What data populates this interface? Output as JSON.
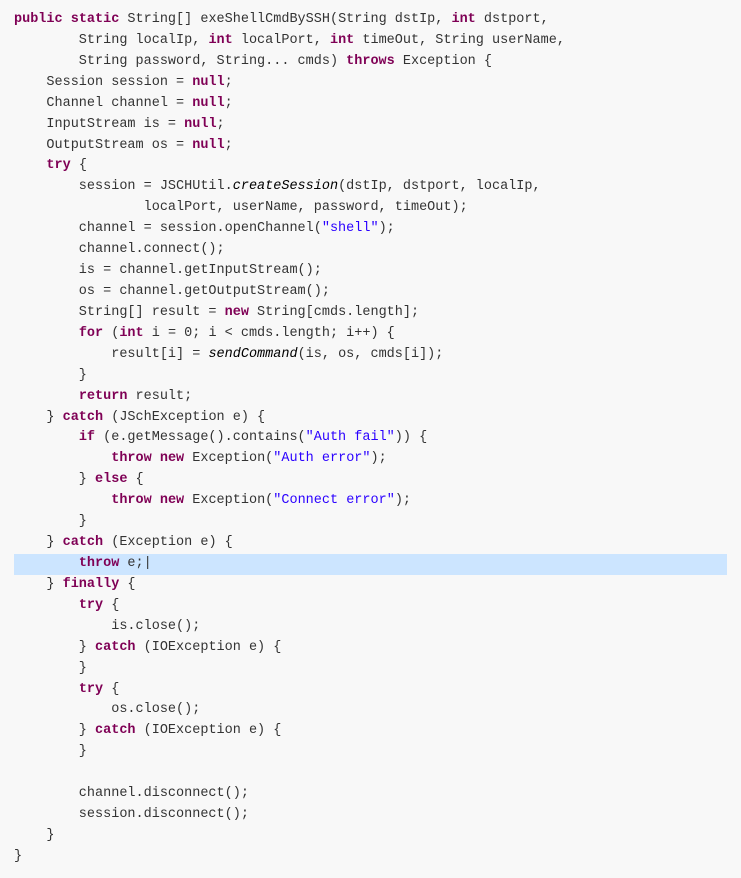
{
  "code": {
    "highlighted_line": 27,
    "lines": [
      {
        "id": 1,
        "html": "<span class='kw'>public</span> <span class='kw'>static</span> String[] exeShellCmdBySSH(String dstIp, <span class='kw'>int</span> dstport,"
      },
      {
        "id": 2,
        "html": "        String localIp, <span class='kw'>int</span> localPort, <span class='kw'>int</span> timeOut, String userName,"
      },
      {
        "id": 3,
        "html": "        String password, String... cmds) <span class='kw'>throws</span> Exception {"
      },
      {
        "id": 4,
        "html": "    Session session = <span class='kw'>null</span>;"
      },
      {
        "id": 5,
        "html": "    Channel channel = <span class='kw'>null</span>;"
      },
      {
        "id": 6,
        "html": "    InputStream is = <span class='kw'>null</span>;"
      },
      {
        "id": 7,
        "html": "    OutputStream os = <span class='kw'>null</span>;"
      },
      {
        "id": 8,
        "html": "    <span class='kw'>try</span> {"
      },
      {
        "id": 9,
        "html": "        session = JSCHUtil.<span class='method-italic'>createSession</span>(dstIp, dstport, localIp,"
      },
      {
        "id": 10,
        "html": "                localPort, userName, password, timeOut);"
      },
      {
        "id": 11,
        "html": "        channel = session.openChannel(<span class='str'>\"shell\"</span>);"
      },
      {
        "id": 12,
        "html": "        channel.connect();"
      },
      {
        "id": 13,
        "html": "        is = channel.getInputStream();"
      },
      {
        "id": 14,
        "html": "        os = channel.getOutputStream();"
      },
      {
        "id": 15,
        "html": "        String[] result = <span class='kw'>new</span> String[cmds.length];"
      },
      {
        "id": 16,
        "html": "        <span class='kw'>for</span> (<span class='kw'>int</span> i = 0; i &lt; cmds.length; i++) {"
      },
      {
        "id": 17,
        "html": "            result[i] = <span class='method-italic'>sendCommand</span>(is, os, cmds[i]);"
      },
      {
        "id": 18,
        "html": "        }"
      },
      {
        "id": 19,
        "html": "        <span class='kw'>return</span> result;"
      },
      {
        "id": 20,
        "html": "    } <span class='kw'>catch</span> (JSchException e) {"
      },
      {
        "id": 21,
        "html": "        <span class='kw'>if</span> (e.getMessage().contains(<span class='str'>\"Auth fail\"</span>)) {"
      },
      {
        "id": 22,
        "html": "            <span class='kw'>throw</span> <span class='kw'>new</span> Exception(<span class='str'>\"Auth error\"</span>);"
      },
      {
        "id": 23,
        "html": "        } <span class='kw'>else</span> {"
      },
      {
        "id": 24,
        "html": "            <span class='kw'>throw</span> <span class='kw'>new</span> Exception(<span class='str'>\"Connect error\"</span>);"
      },
      {
        "id": 25,
        "html": "        }"
      },
      {
        "id": 26,
        "html": "    } <span class='kw'>catch</span> (Exception e) {"
      },
      {
        "id": 27,
        "html": "        <span class='kw'>throw</span> e;|"
      },
      {
        "id": 28,
        "html": "    } <span class='kw'>finally</span> {"
      },
      {
        "id": 29,
        "html": "        <span class='kw'>try</span> {"
      },
      {
        "id": 30,
        "html": "            is.close();"
      },
      {
        "id": 31,
        "html": "        } <span class='kw'>catch</span> (IOException e) {"
      },
      {
        "id": 32,
        "html": "        }"
      },
      {
        "id": 33,
        "html": "        <span class='kw'>try</span> {"
      },
      {
        "id": 34,
        "html": "            os.close();"
      },
      {
        "id": 35,
        "html": "        } <span class='kw'>catch</span> (IOException e) {"
      },
      {
        "id": 36,
        "html": "        }"
      },
      {
        "id": 37,
        "html": ""
      },
      {
        "id": 38,
        "html": "        channel.disconnect();"
      },
      {
        "id": 39,
        "html": "        session.disconnect();"
      },
      {
        "id": 40,
        "html": "    }"
      },
      {
        "id": 41,
        "html": "}"
      }
    ]
  }
}
